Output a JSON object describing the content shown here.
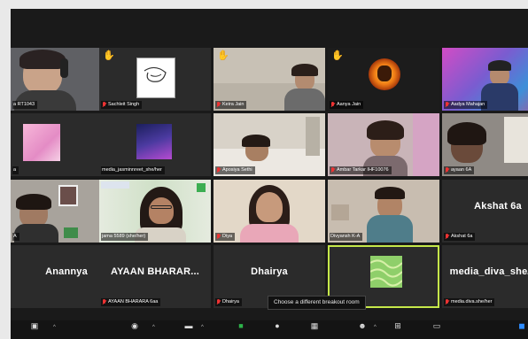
{
  "tiles": [
    {
      "name": "a RT1043",
      "muted": false,
      "hand": false
    },
    {
      "name": "Sachleit Singh",
      "muted": true,
      "hand": true
    },
    {
      "name": "Keira Jain",
      "muted": true,
      "hand": true
    },
    {
      "name": "Aanya Jain",
      "muted": true,
      "hand": true
    },
    {
      "name": "Aadya Mahajan",
      "muted": true,
      "hand": false
    },
    {
      "name": "a",
      "muted": false,
      "hand": false
    },
    {
      "name": "media_jasminnreet_she/her",
      "muted": false,
      "hand": false
    },
    {
      "name": "Aposiya Sethi",
      "muted": true,
      "hand": false
    },
    {
      "name": "Ambar Tarkar IHF10076",
      "muted": true,
      "hand": false
    },
    {
      "name": "ayaan 6A",
      "muted": true,
      "hand": false
    },
    {
      "name": "A",
      "muted": false,
      "hand": false
    },
    {
      "name": "jama 5589 (she/her)",
      "muted": false,
      "hand": false
    },
    {
      "name": "Diya",
      "muted": true,
      "hand": false
    },
    {
      "name": "Divyansh K-A",
      "muted": false,
      "hand": false
    },
    {
      "name": "Akshat 6a",
      "display": "Akshat 6a",
      "muted": true,
      "hand": false
    },
    {
      "name": "Anannya",
      "display": "Anannya",
      "muted": false,
      "hand": false
    },
    {
      "name": "AYAAN BHARARA 6aa",
      "display": "AYAAN BHARAR...",
      "muted": true,
      "hand": false
    },
    {
      "name": "Dhairya",
      "display": "Dhairya",
      "muted": true,
      "hand": false
    },
    {
      "name": "",
      "muted": false,
      "hand": false
    },
    {
      "name": "media.diva.she/her",
      "display": "media_diva_she/her",
      "muted": true,
      "hand": false
    }
  ],
  "tooltip": "Choose a different breakout room",
  "icons": {
    "hand": "raised-hand-icon",
    "mic": "mic-muted-icon"
  },
  "colors": {
    "speaking_highlight": "#c6e84a",
    "muted_red": "#e33333",
    "share_green": "#2db34a"
  }
}
